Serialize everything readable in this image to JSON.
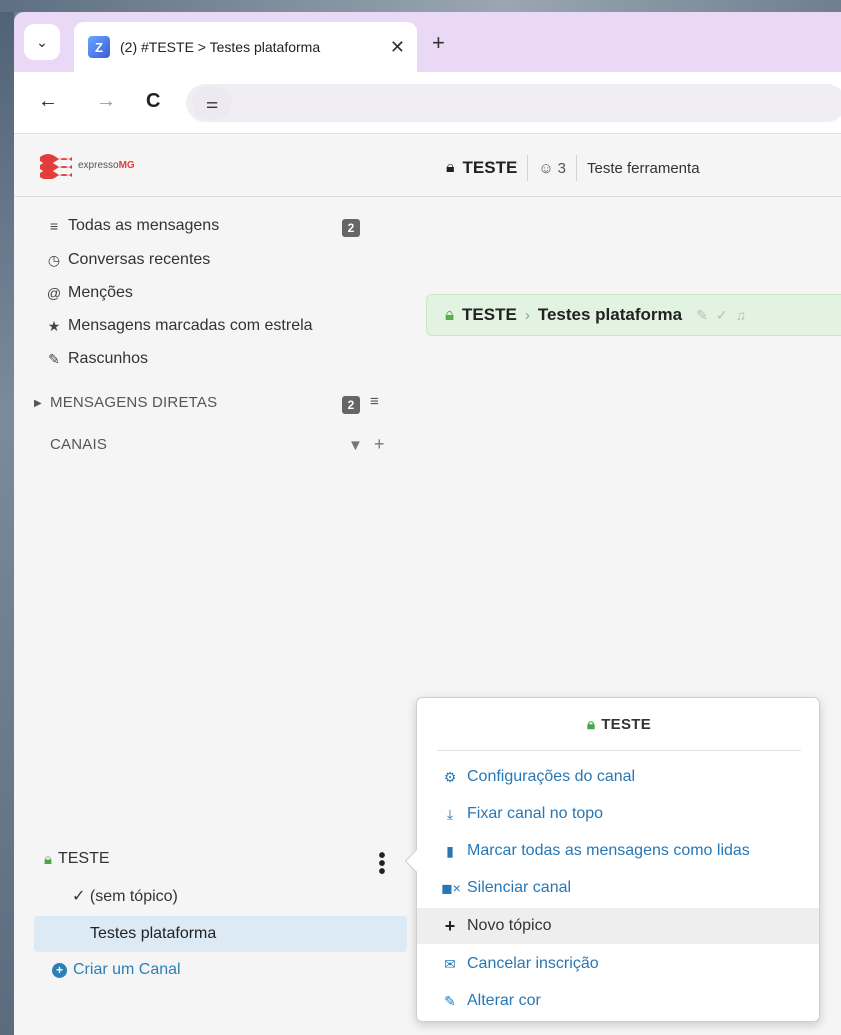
{
  "browser": {
    "tab_title": "(2) #TESTE > Testes plataforma",
    "favicon_letter": "Z",
    "tab_close": "✕",
    "new_tab": "+"
  },
  "toolbar": {
    "back": "←",
    "forward": "→",
    "reload": "C",
    "site_info": "⚌"
  },
  "app": {
    "logo_text_prefix": "expresso",
    "logo_text_suffix": "MG",
    "header_channel": "TESTE",
    "header_user_count": "3",
    "header_description": "Teste ferramenta"
  },
  "sidebar": {
    "items": [
      {
        "icon": "list-icon",
        "label": "Todas as mensagens",
        "badge": "2"
      },
      {
        "icon": "clock-icon",
        "label": "Conversas recentes"
      },
      {
        "icon": "at-icon",
        "label": "Menções"
      },
      {
        "icon": "star-icon",
        "label": "Mensagens marcadas com estrela"
      },
      {
        "icon": "pencil-icon",
        "label": "Rascunhos"
      }
    ],
    "direct_messages": {
      "label": "MENSAGENS DIRETAS",
      "badge": "2"
    },
    "channels": {
      "label": "CANAIS"
    },
    "channel": {
      "name": "TESTE"
    },
    "topics": [
      {
        "label": "(sem tópico)"
      },
      {
        "label": "Testes plataforma"
      }
    ],
    "create_channel": "Criar um Canal"
  },
  "recipient_bar": {
    "channel": "TESTE",
    "topic": "Testes plataforma"
  },
  "popover": {
    "title": "TESTE",
    "items": [
      {
        "icon": "gear-icon",
        "label": "Configurações do canal"
      },
      {
        "icon": "pin-icon",
        "label": "Fixar canal no topo"
      },
      {
        "icon": "book-icon",
        "label": "Marcar todas as mensagens como lidas"
      },
      {
        "icon": "mute-icon",
        "label": "Silenciar canal"
      },
      {
        "icon": "plus-icon",
        "label": "Novo tópico"
      },
      {
        "icon": "envelope-icon",
        "label": "Cancelar inscrição"
      },
      {
        "icon": "eyedropper-icon",
        "label": "Alterar cor"
      }
    ]
  },
  "colors": {
    "link": "#2877b4",
    "lock_green": "#4aa64a",
    "tab_strip": "#e9d9f6",
    "topic_highlight": "#dceaf5"
  }
}
